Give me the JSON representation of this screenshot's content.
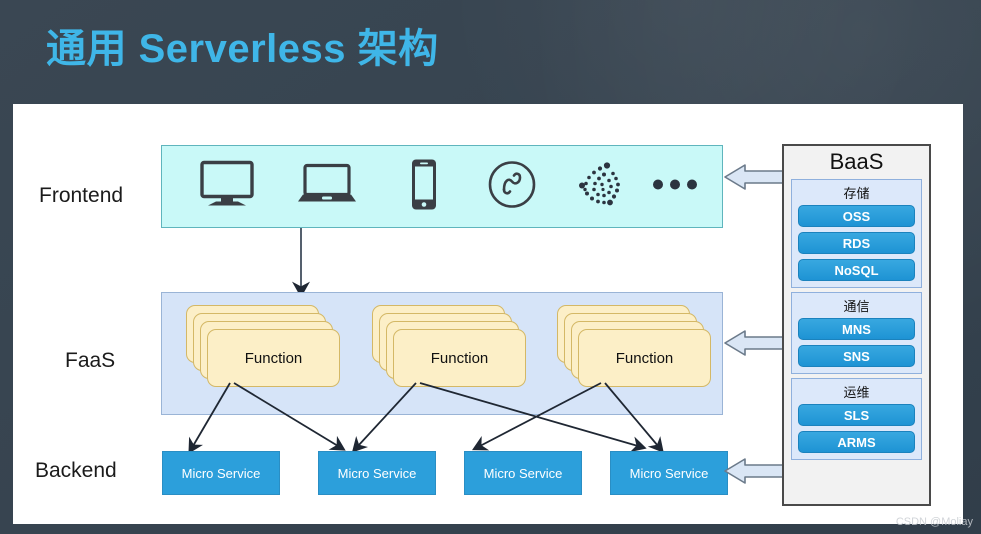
{
  "slide": {
    "title": "通用 Serverless 架构",
    "title_color": "#3fb6e8",
    "background_color": "#36434f",
    "canvas_color": "#ffffff"
  },
  "rows": {
    "frontend_label": "Frontend",
    "faas_label": "FaaS",
    "backend_label": "Backend"
  },
  "frontend": {
    "band_color": "#c9f9f8",
    "band_border": "#5fb5bd",
    "icons": [
      {
        "name": "desktop-monitor-icon",
        "label": "Desktop"
      },
      {
        "name": "laptop-icon",
        "label": "Laptop"
      },
      {
        "name": "smartphone-icon",
        "label": "Mobile"
      },
      {
        "name": "wechat-miniprogram-icon",
        "label": "Mini Program"
      },
      {
        "name": "iot-dots-icon",
        "label": "IoT"
      },
      {
        "name": "ellipsis-icon",
        "label": "..."
      }
    ]
  },
  "faas": {
    "band_color": "#d6e4f8",
    "band_border": "#9ab4d6",
    "card_color": "#fcefc7",
    "card_border": "#d4b866",
    "stacks": [
      {
        "label": "Function",
        "layers": 4
      },
      {
        "label": "Function",
        "layers": 4
      },
      {
        "label": "Function",
        "layers": 4
      }
    ]
  },
  "backend": {
    "box_color": "#2c9fdb",
    "services": [
      {
        "label": "Micro Service"
      },
      {
        "label": "Micro Service"
      },
      {
        "label": "Micro Service"
      },
      {
        "label": "Micro Service"
      }
    ]
  },
  "baas": {
    "title": "BaaS",
    "panel_color": "#f2f2f2",
    "panel_border": "#4a4a4a",
    "group_color": "#dce8fa",
    "item_color": "#2c9fdb",
    "groups": [
      {
        "title": "存储",
        "items": [
          {
            "label": "OSS"
          },
          {
            "label": "RDS"
          },
          {
            "label": "NoSQL"
          }
        ]
      },
      {
        "title": "通信",
        "items": [
          {
            "label": "MNS"
          },
          {
            "label": "SNS"
          }
        ]
      },
      {
        "title": "运维",
        "items": [
          {
            "label": "SLS"
          },
          {
            "label": "ARMS"
          }
        ]
      }
    ]
  },
  "connectors": {
    "frontend_to_faas": "down-arrow",
    "baas_arrow_color": "#dae6f5",
    "baas_arrow_border": "#6b7a8a",
    "faas_to_backend": "crossed-arrows"
  },
  "watermark": "CSDN @Moliay"
}
